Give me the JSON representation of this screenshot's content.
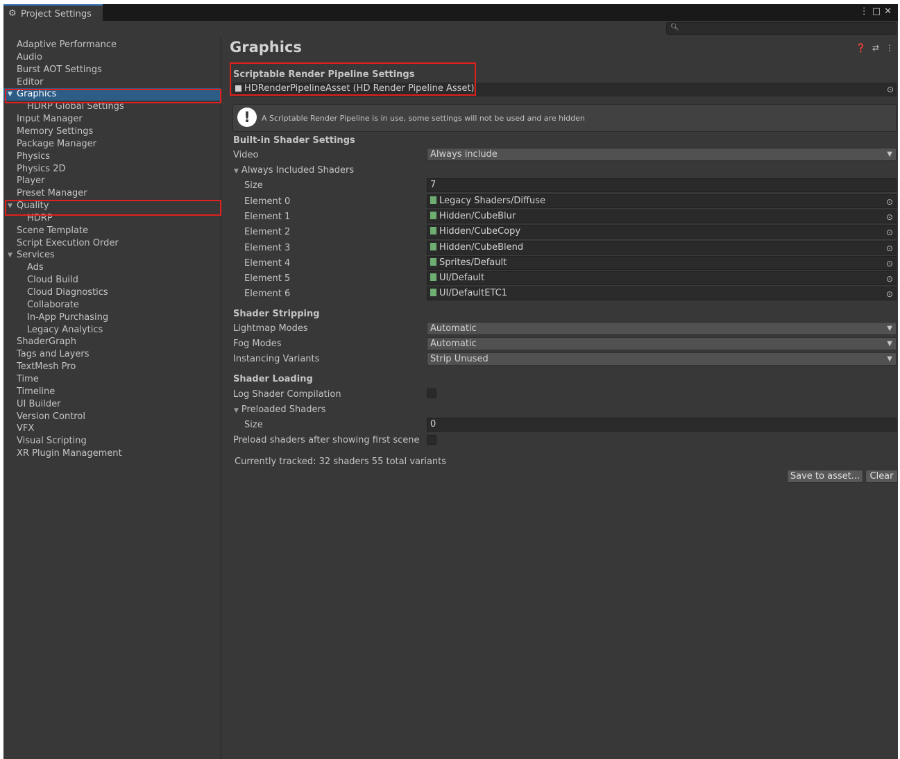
{
  "window": {
    "tab_title": "Project Settings",
    "controls": [
      "⋮",
      "□",
      "✕"
    ]
  },
  "search": {
    "placeholder": ""
  },
  "sidebar": {
    "items": [
      {
        "label": "Adaptive Performance"
      },
      {
        "label": "Audio"
      },
      {
        "label": "Burst AOT Settings"
      },
      {
        "label": "Editor"
      },
      {
        "label": "Graphics",
        "expanded": true,
        "selected": true
      },
      {
        "label": "HDRP Global Settings",
        "child": true
      },
      {
        "label": "Input Manager"
      },
      {
        "label": "Memory Settings"
      },
      {
        "label": "Package Manager"
      },
      {
        "label": "Physics"
      },
      {
        "label": "Physics 2D"
      },
      {
        "label": "Player"
      },
      {
        "label": "Preset Manager"
      },
      {
        "label": "Quality",
        "expanded": true
      },
      {
        "label": "HDRP",
        "child": true
      },
      {
        "label": "Scene Template"
      },
      {
        "label": "Script Execution Order"
      },
      {
        "label": "Services",
        "expanded": true
      },
      {
        "label": "Ads",
        "child": true
      },
      {
        "label": "Cloud Build",
        "child": true
      },
      {
        "label": "Cloud Diagnostics",
        "child": true
      },
      {
        "label": "Collaborate",
        "child": true
      },
      {
        "label": "In-App Purchasing",
        "child": true
      },
      {
        "label": "Legacy Analytics",
        "child": true
      },
      {
        "label": "ShaderGraph"
      },
      {
        "label": "Tags and Layers"
      },
      {
        "label": "TextMesh Pro"
      },
      {
        "label": "Time"
      },
      {
        "label": "Timeline"
      },
      {
        "label": "UI Builder"
      },
      {
        "label": "Version Control"
      },
      {
        "label": "VFX"
      },
      {
        "label": "Visual Scripting"
      },
      {
        "label": "XR Plugin Management"
      }
    ]
  },
  "main": {
    "title": "Graphics",
    "srp": {
      "header": "Scriptable Render Pipeline Settings",
      "asset": "HDRenderPipelineAsset (HD Render Pipeline Asset)"
    },
    "info": "A Scriptable Render Pipeline is in use, some settings will not be used and are hidden",
    "builtin": {
      "header": "Built-in Shader Settings",
      "video_label": "Video",
      "video_value": "Always include",
      "always_included": "Always Included Shaders",
      "size_label": "Size",
      "size_value": "7",
      "elements": [
        {
          "label": "Element 0",
          "value": "Legacy Shaders/Diffuse"
        },
        {
          "label": "Element 1",
          "value": "Hidden/CubeBlur"
        },
        {
          "label": "Element 2",
          "value": "Hidden/CubeCopy"
        },
        {
          "label": "Element 3",
          "value": "Hidden/CubeBlend"
        },
        {
          "label": "Element 4",
          "value": "Sprites/Default"
        },
        {
          "label": "Element 5",
          "value": "UI/Default"
        },
        {
          "label": "Element 6",
          "value": "UI/DefaultETC1"
        }
      ]
    },
    "stripping": {
      "header": "Shader Stripping",
      "lightmap_label": "Lightmap Modes",
      "lightmap_value": "Automatic",
      "fog_label": "Fog Modes",
      "fog_value": "Automatic",
      "instancing_label": "Instancing Variants",
      "instancing_value": "Strip Unused"
    },
    "loading": {
      "header": "Shader Loading",
      "log_label": "Log Shader Compilation",
      "log_checked": false,
      "preloaded": "Preloaded Shaders",
      "size_label": "Size",
      "size_value": "0",
      "preload_after_label": "Preload shaders after showing first scene",
      "preload_after_checked": false,
      "tracked": "Currently tracked: 32 shaders 55 total variants",
      "save_button": "Save to asset...",
      "clear_button": "Clear"
    }
  },
  "colors": {
    "highlight": "#e01f1f",
    "selection": "#2c5d87",
    "background": "#383838"
  }
}
